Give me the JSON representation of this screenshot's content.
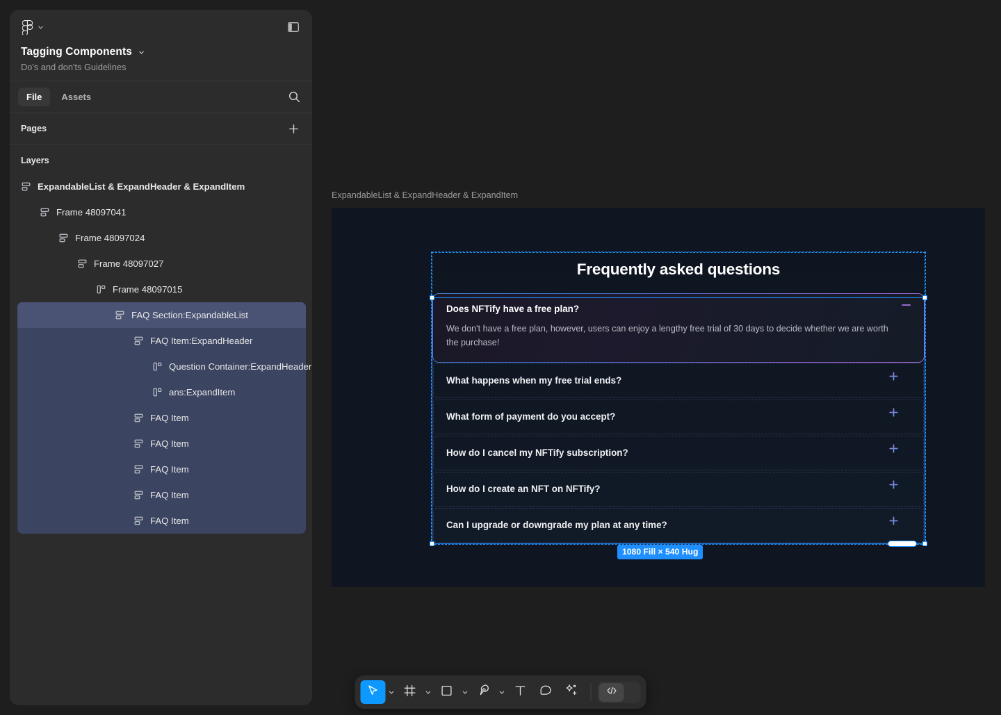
{
  "app": {
    "logo_icon": "figma-logo-icon",
    "menu_chevron_icon": "chevron-down-icon",
    "panel_toggle_icon": "panel-layout-icon"
  },
  "sidebar": {
    "file_title": "Tagging Components",
    "file_title_chevron_icon": "chevron-down-icon",
    "file_subtitle": "Do's and don'ts Guidelines",
    "tabs": [
      {
        "label": "File",
        "active": true
      },
      {
        "label": "Assets",
        "active": false
      }
    ],
    "search_icon": "search-icon",
    "pages": {
      "title": "Pages",
      "add_icon": "plus-icon"
    },
    "layers": {
      "title": "Layers"
    },
    "layer_items": [
      {
        "label": "ExpandableList & ExpandHeader & ExpandItem",
        "indent": 0,
        "icon": "auto-layout-vertical-icon",
        "bold": true,
        "state": "none"
      },
      {
        "label": "Frame 48097041",
        "indent": 1,
        "icon": "auto-layout-vertical-icon",
        "bold": false,
        "state": "none"
      },
      {
        "label": "Frame 48097024",
        "indent": 2,
        "icon": "auto-layout-vertical-icon",
        "bold": false,
        "state": "none"
      },
      {
        "label": "Frame 48097027",
        "indent": 3,
        "icon": "auto-layout-vertical-icon",
        "bold": false,
        "state": "none"
      },
      {
        "label": "Frame 48097015",
        "indent": 4,
        "icon": "auto-layout-horizontal-icon",
        "bold": false,
        "state": "none"
      },
      {
        "label": "FAQ Section:ExpandableList",
        "indent": 5,
        "icon": "auto-layout-vertical-icon",
        "bold": false,
        "state": "selected"
      },
      {
        "label": "FAQ Item:ExpandHeader",
        "indent": 6,
        "icon": "auto-layout-vertical-icon",
        "bold": false,
        "state": "selected-child"
      },
      {
        "label": "Question Container:ExpandHeader",
        "indent": 7,
        "icon": "auto-layout-horizontal-icon",
        "bold": false,
        "state": "selected-child"
      },
      {
        "label": "ans:ExpandItem",
        "indent": 7,
        "icon": "auto-layout-horizontal-icon",
        "bold": false,
        "state": "selected-child"
      },
      {
        "label": "FAQ Item",
        "indent": 6,
        "icon": "auto-layout-vertical-icon",
        "bold": false,
        "state": "selected-child"
      },
      {
        "label": "FAQ Item",
        "indent": 6,
        "icon": "auto-layout-vertical-icon",
        "bold": false,
        "state": "selected-child"
      },
      {
        "label": "FAQ Item",
        "indent": 6,
        "icon": "auto-layout-vertical-icon",
        "bold": false,
        "state": "selected-child"
      },
      {
        "label": "FAQ Item",
        "indent": 6,
        "icon": "auto-layout-vertical-icon",
        "bold": false,
        "state": "selected-child"
      },
      {
        "label": "FAQ Item",
        "indent": 6,
        "icon": "auto-layout-vertical-icon",
        "bold": false,
        "state": "selected-child"
      }
    ]
  },
  "canvas": {
    "frame_label": "ExpandableList & ExpandHeader & ExpandItem",
    "size_badge": "1080 Fill × 540 Hug",
    "faq": {
      "title": "Frequently asked questions",
      "expanded": {
        "question": "Does NFTify have a free plan?",
        "answer": "We don't have a free plan, however, users can enjoy a lengthy free trial of 30 days to decide whether we are worth the purchase!",
        "toggle_icon": "minus-icon"
      },
      "collapsed": [
        {
          "question": "What happens when my free trial ends?",
          "toggle_icon": "plus-icon"
        },
        {
          "question": "What form of payment do you accept?",
          "toggle_icon": "plus-icon"
        },
        {
          "question": "How do I cancel my NFTify subscription?",
          "toggle_icon": "plus-icon"
        },
        {
          "question": "How do I create an NFT on NFTify?",
          "toggle_icon": "plus-icon"
        },
        {
          "question": "Can I upgrade or downgrade my plan at any time?",
          "toggle_icon": "plus-icon"
        }
      ]
    }
  },
  "toolbar": {
    "tools": [
      {
        "name": "move-tool",
        "icon": "cursor-arrow-icon",
        "active": true,
        "has_chevron": true
      },
      {
        "name": "frame-tool",
        "icon": "frame-icon",
        "active": false,
        "has_chevron": true
      },
      {
        "name": "shape-tool",
        "icon": "square-icon",
        "active": false,
        "has_chevron": true
      },
      {
        "name": "pen-tool",
        "icon": "pen-icon",
        "active": false,
        "has_chevron": true
      },
      {
        "name": "text-tool",
        "icon": "text-t-icon",
        "active": false,
        "has_chevron": false
      },
      {
        "name": "comment-tool",
        "icon": "comment-bubble-icon",
        "active": false,
        "has_chevron": false
      },
      {
        "name": "actions-tool",
        "icon": "sparkle-plus-icon",
        "active": false,
        "has_chevron": false
      }
    ],
    "dev_mode": {
      "name": "dev-mode-toggle",
      "icon": "code-brackets-icon",
      "on": false
    }
  },
  "colors": {
    "accent_blue": "#0d99ff",
    "selection_blue": "#1f8fff",
    "sidebar_bg": "#2c2c2c",
    "app_bg": "#1e1e1e",
    "frame_bg": "#0f1621",
    "layer_selected": "#4a5373",
    "layer_selected_child": "#3b4460",
    "gradient_purple": "#a36fd0",
    "gradient_blue": "#4a7fd4"
  }
}
